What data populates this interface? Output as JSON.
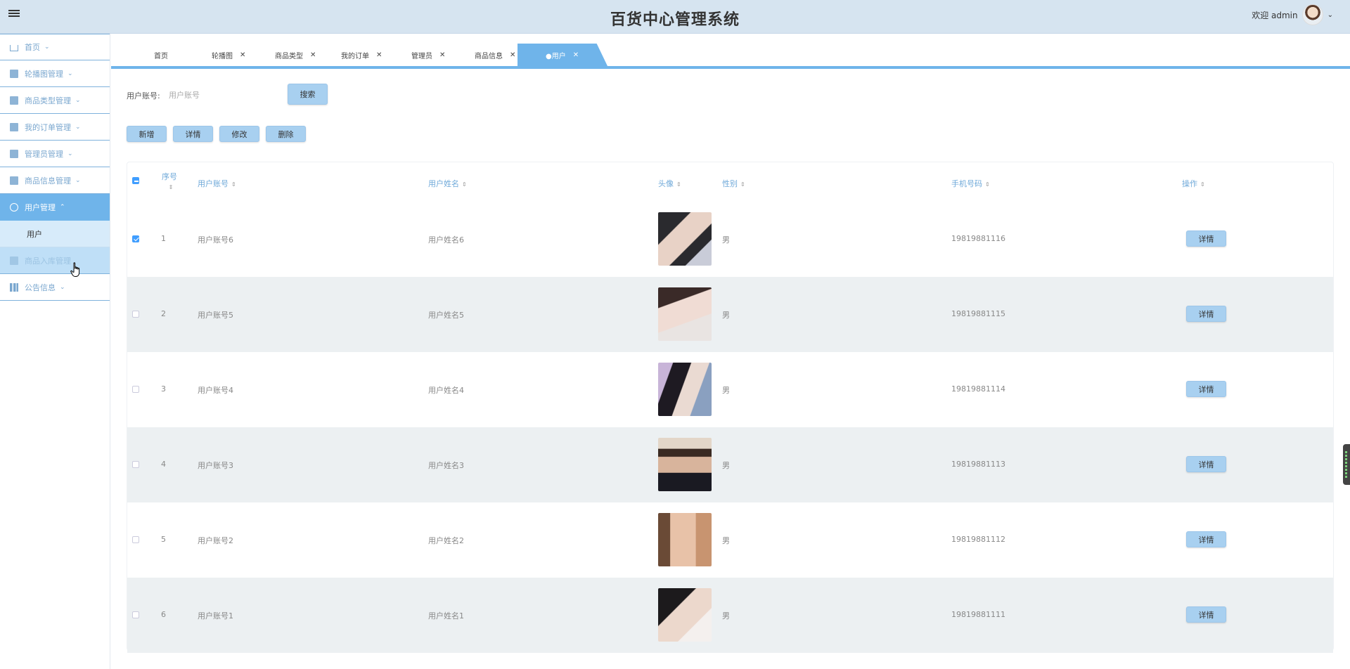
{
  "header": {
    "title": "百货中心管理系统",
    "welcome": "欢迎 admin"
  },
  "sidebar": {
    "items": [
      {
        "label": "首页",
        "icon": "home-icon",
        "state": "normal"
      },
      {
        "label": "轮播图管理",
        "icon": "carousel-icon",
        "state": "normal"
      },
      {
        "label": "商品类型管理",
        "icon": "shop-icon",
        "state": "normal"
      },
      {
        "label": "我的订单管理",
        "icon": "order-icon",
        "state": "normal"
      },
      {
        "label": "管理员管理",
        "icon": "admin-icon",
        "state": "normal"
      },
      {
        "label": "商品信息管理",
        "icon": "briefcase-icon",
        "state": "normal"
      },
      {
        "label": "用户管理",
        "icon": "user-icon",
        "state": "active"
      },
      {
        "label": "商品入库管理",
        "icon": "warehouse-icon",
        "state": "hover"
      },
      {
        "label": "公告信息",
        "icon": "notice-icon",
        "state": "normal"
      }
    ],
    "sub_item": "用户"
  },
  "tabs": [
    {
      "label": "首页",
      "closable": false
    },
    {
      "label": "轮播图",
      "closable": true
    },
    {
      "label": "商品类型",
      "closable": true
    },
    {
      "label": "我的订单",
      "closable": true
    },
    {
      "label": "管理员",
      "closable": true
    },
    {
      "label": "商品信息",
      "closable": true
    },
    {
      "label": "●用户",
      "closable": true,
      "active": true
    }
  ],
  "search": {
    "label": "用户账号:",
    "placeholder": "用户账号",
    "button": "搜索"
  },
  "actions": {
    "add": "新增",
    "detail": "详情",
    "edit": "修改",
    "delete": "删除"
  },
  "table": {
    "columns": {
      "index": "序号",
      "account": "用户账号",
      "name": "用户姓名",
      "avatar": "头像",
      "gender": "性别",
      "phone": "手机号码",
      "ops": "操作"
    },
    "rows": [
      {
        "index": "1",
        "account": "用户账号6",
        "name": "用户姓名6",
        "gender": "男",
        "phone": "19819881116",
        "checked": true
      },
      {
        "index": "2",
        "account": "用户账号5",
        "name": "用户姓名5",
        "gender": "男",
        "phone": "19819881115",
        "checked": false
      },
      {
        "index": "3",
        "account": "用户账号4",
        "name": "用户姓名4",
        "gender": "男",
        "phone": "19819881114",
        "checked": false
      },
      {
        "index": "4",
        "account": "用户账号3",
        "name": "用户姓名3",
        "gender": "男",
        "phone": "19819881113",
        "checked": false
      },
      {
        "index": "5",
        "account": "用户账号2",
        "name": "用户姓名2",
        "gender": "男",
        "phone": "19819881112",
        "checked": false
      },
      {
        "index": "6",
        "account": "用户账号1",
        "name": "用户姓名1",
        "gender": "男",
        "phone": "19819881111",
        "checked": false
      }
    ],
    "detail_button": "详情"
  },
  "colors": {
    "accent": "#6fb4ea",
    "header_bg": "#d6e4f0",
    "button_bg": "#a8d0f0"
  }
}
